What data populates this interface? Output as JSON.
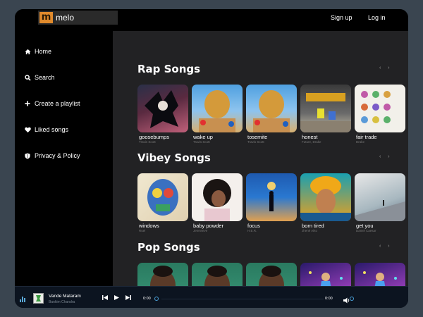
{
  "brand": {
    "logo_letter": "m",
    "name": "melo"
  },
  "header": {
    "signup": "Sign up",
    "login": "Log in"
  },
  "sidebar": {
    "items": [
      {
        "label": "Home",
        "icon": "home-icon"
      },
      {
        "label": "Search",
        "icon": "search-icon"
      },
      {
        "label": "Create a playlist",
        "icon": "plus-icon"
      },
      {
        "label": "Liked songs",
        "icon": "heart-icon"
      },
      {
        "label": "Privacy & Policy",
        "icon": "shield-icon"
      }
    ]
  },
  "sections": [
    {
      "title": "Rap Songs",
      "arrows": "‹ ›",
      "cards": [
        {
          "title": "goosebumps",
          "sub": "Travis Scott"
        },
        {
          "title": "wake up",
          "sub": "Travis Scott"
        },
        {
          "title": "tosemite",
          "sub": "Travis Scott"
        },
        {
          "title": "honest",
          "sub": "Future, Drake"
        },
        {
          "title": "fair trade",
          "sub": "Drake"
        }
      ]
    },
    {
      "title": "Vibey Songs",
      "arrows": "‹ ›",
      "cards": [
        {
          "title": "windows",
          "sub": "Ruel"
        },
        {
          "title": "baby powder",
          "sub": "Jenevieve"
        },
        {
          "title": "focus",
          "sub": "H.E.R."
        },
        {
          "title": "born tired",
          "sub": "Jhené Aiko"
        },
        {
          "title": "get you",
          "sub": "Daniel Caesar"
        }
      ]
    },
    {
      "title": "Pop Songs",
      "arrows": "‹ ›",
      "cards": [
        {
          "title": "",
          "sub": ""
        },
        {
          "title": "",
          "sub": ""
        },
        {
          "title": "",
          "sub": ""
        },
        {
          "title": "",
          "sub": ""
        },
        {
          "title": "",
          "sub": ""
        }
      ]
    }
  ],
  "player": {
    "title": "Vande Mataram",
    "artist": "Bankim Chandra",
    "current_time": "0:00",
    "total_time": "0:00",
    "progress": 0
  },
  "colors": {
    "accent": "#4aa0d8",
    "logo": "#e08a2c",
    "background": "#3a4550",
    "main": "#222224"
  }
}
